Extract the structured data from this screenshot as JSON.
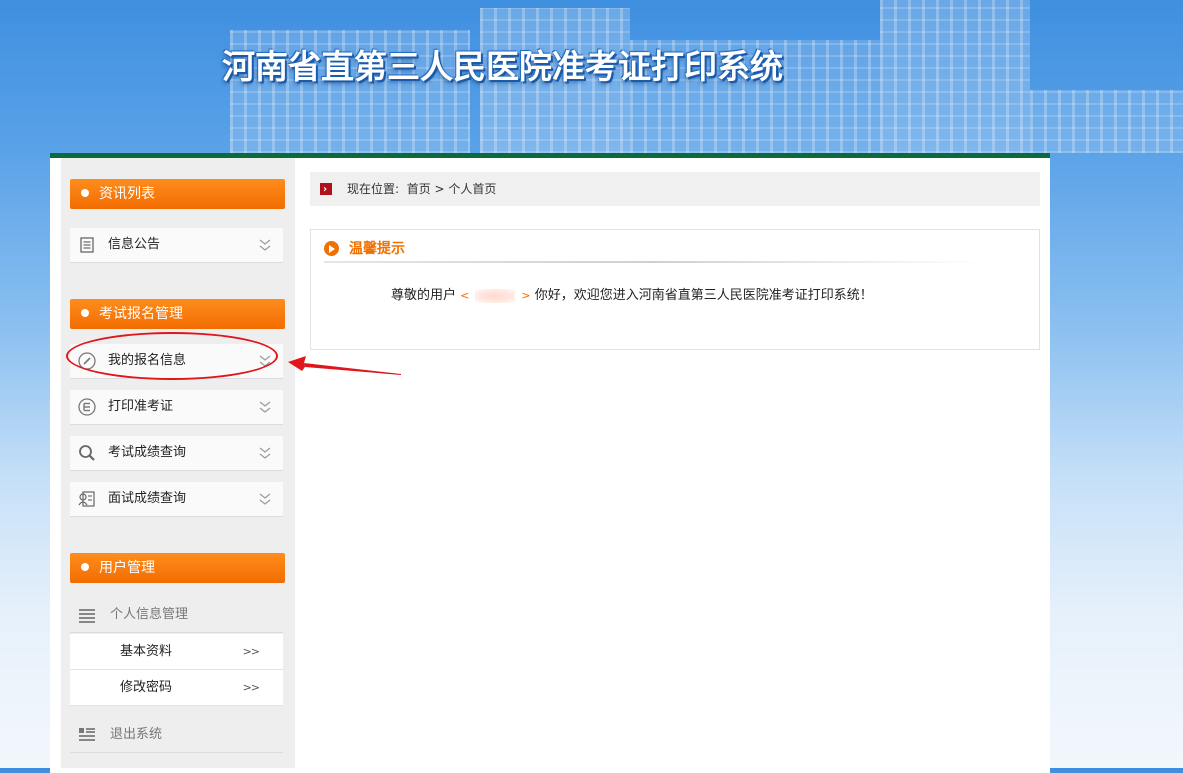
{
  "header": {
    "title": "河南省直第三人民医院准考证打印系统"
  },
  "sidebar": {
    "groups": [
      {
        "title": "资讯列表",
        "items": [
          {
            "label": "信息公告",
            "icon": "document-list-icon"
          }
        ]
      },
      {
        "title": "考试报名管理",
        "items": [
          {
            "label": "我的报名信息",
            "icon": "pencil-edit-icon"
          },
          {
            "label": "打印准考证",
            "icon": "printer-circle-icon"
          },
          {
            "label": "考试成绩查询",
            "icon": "search-icon"
          },
          {
            "label": "面试成绩查询",
            "icon": "person-document-icon"
          }
        ]
      },
      {
        "title": "用户管理",
        "items": [
          {
            "label": "个人信息管理",
            "icon": "list-lines-icon"
          },
          {
            "label": "基本资料",
            "arrow": ">>"
          },
          {
            "label": "修改密码",
            "arrow": ">>"
          },
          {
            "label": "退出系统",
            "icon": "exit-list-icon"
          }
        ]
      }
    ]
  },
  "breadcrumb": {
    "icon_glyph": "›",
    "prefix": "现在位置:",
    "home": "首页",
    "separator": ">",
    "current": "个人首页"
  },
  "notice": {
    "title": "温馨提示",
    "greeting_prefix": "尊敬的用户",
    "bracket_open": "<",
    "bracket_close": ">",
    "greeting_suffix": "你好，欢迎您进入河南省直第三人民医院准考证打印系统！"
  },
  "colors": {
    "accent_orange": "#f26c00",
    "header_green": "#0b6b3a",
    "annotation_red": "#e0161b"
  }
}
